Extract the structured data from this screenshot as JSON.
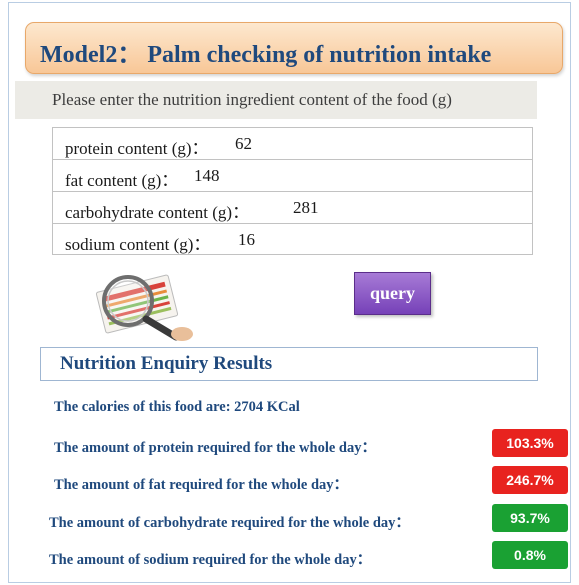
{
  "title": "Model2： Palm checking of nutrition intake",
  "instruction": "Please enter the nutrition ingredient content of the food (g)",
  "fields": [
    {
      "label": "protein content (g)：",
      "value": "62"
    },
    {
      "label": "fat content (g)：",
      "value": "148"
    },
    {
      "label": "carbohydrate content (g)：",
      "value": "281"
    },
    {
      "label": "sodium content (g)：",
      "value": "16"
    }
  ],
  "query_label": "query",
  "results": {
    "header": "Nutrition Enquiry Results",
    "calories": "The calories of this food are: 2704 KCal",
    "rows": [
      {
        "text": "The amount of protein required for the whole day：",
        "pct": "103.3%",
        "status": "over"
      },
      {
        "text": "The amount of fat required for the whole day：",
        "pct": "246.7%",
        "status": "over"
      },
      {
        "text": "The amount of carbohydrate required for the whole day：",
        "pct": "93.7%",
        "status": "ok"
      },
      {
        "text": "The amount of sodium required for the whole day：",
        "pct": "0.8%",
        "status": "ok"
      }
    ]
  },
  "colors": {
    "title_text": "#1f497d",
    "over": "#e8231f",
    "ok": "#1aa133",
    "query_button": "#8a56c4"
  },
  "icons": {
    "illustration": "magnifying-glass-over-nutrition-label"
  }
}
